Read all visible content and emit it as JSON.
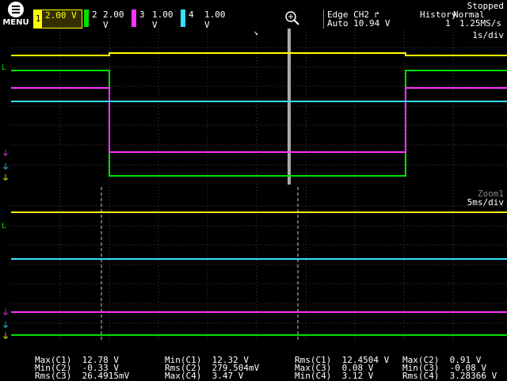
{
  "menu": {
    "label": "MENU",
    "icon": "hamburger-icon"
  },
  "channels": [
    {
      "id": "1",
      "volts": "2.00 V",
      "color": "#ffff00",
      "selected": true
    },
    {
      "id": "2",
      "volts": "2.00 V",
      "color": "#00e000"
    },
    {
      "id": "3",
      "volts": "1.00 V",
      "color": "#ff33ff"
    },
    {
      "id": "4",
      "volts": "1.00 V",
      "color": "#33e0ff"
    }
  ],
  "trigger": {
    "line1": "Edge CH2 ↱",
    "line2": "Auto 10.94 V"
  },
  "history": {
    "label": "History",
    "value": "1"
  },
  "acq": {
    "mode": "Normal",
    "rate": "1.25MS/s"
  },
  "status": "Stopped",
  "main_plot": {
    "timebase": "1s/div"
  },
  "zoom_plot": {
    "title": "Zoom1",
    "timebase": "5ms/div"
  },
  "level_marker": "L",
  "measurements": {
    "col1": [
      "Max(C1)  12.78 V",
      "Min(C2)  -0.33 V",
      "Rms(C3)  26.4915mV"
    ],
    "col2": [
      "Min(C1)  12.32 V",
      "Rms(C2)  279.504mV",
      "Max(C4)  3.47 V"
    ],
    "col3": [
      "Rms(C1)  12.4504 V",
      "Max(C3)  0.08 V",
      "Min(C4)  3.12 V"
    ],
    "col4": [
      "Max(C2)  0.91 V",
      "Min(C3)  -0.08 V",
      "Rms(C4)  3.28366 V"
    ]
  }
}
